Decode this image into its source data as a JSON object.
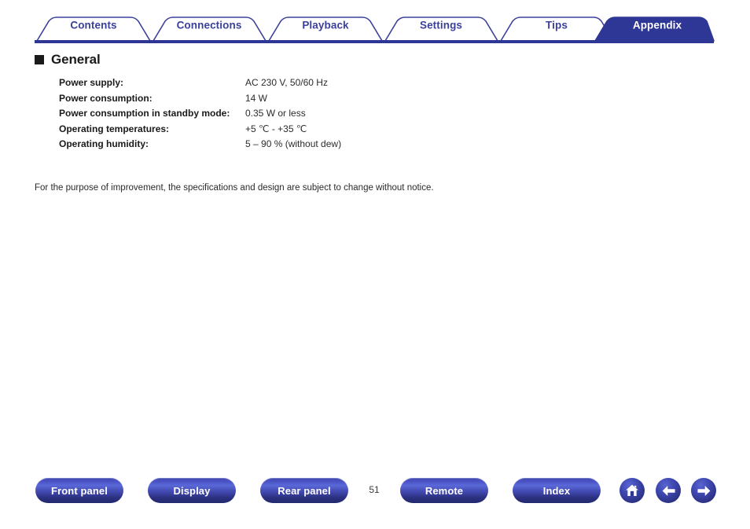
{
  "tabs": [
    {
      "label": "Contents",
      "active": false
    },
    {
      "label": "Connections",
      "active": false
    },
    {
      "label": "Playback",
      "active": false
    },
    {
      "label": "Settings",
      "active": false
    },
    {
      "label": "Tips",
      "active": false
    },
    {
      "label": "Appendix",
      "active": true
    }
  ],
  "section": {
    "title": "General",
    "bullet": "filled-square-bullet"
  },
  "specifications": {
    "rows": [
      {
        "label": "Power supply:",
        "value": "AC 230 V, 50/60 Hz"
      },
      {
        "label": "Power consumption:",
        "value": "14 W"
      },
      {
        "label": "Power consumption in standby mode:",
        "value": "0.35 W or less"
      },
      {
        "label": "Operating temperatures:",
        "value": "+5 ℃ - +35 ℃"
      },
      {
        "label": "Operating humidity:",
        "value": "5 – 90 % (without dew)"
      }
    ]
  },
  "note": "For the purpose of improvement, the specifications and design are subject to change without notice.",
  "footer": {
    "buttons": [
      {
        "label": "Front panel"
      },
      {
        "label": "Display"
      },
      {
        "label": "Rear panel"
      },
      {
        "label": "Remote"
      },
      {
        "label": "Index"
      }
    ],
    "page_number": "51",
    "icons": [
      {
        "name": "home-icon"
      },
      {
        "name": "arrow-left-icon"
      },
      {
        "name": "arrow-right-icon"
      }
    ]
  },
  "colors": {
    "tab_active_fill": "#2f3796",
    "tab_border": "#3b419b",
    "tab_text": "#3b419b",
    "tab_text_active": "#ffffff",
    "rule": "#2f3796",
    "button_blue": "#3f47ae",
    "bullet": "#1a1a1a"
  }
}
